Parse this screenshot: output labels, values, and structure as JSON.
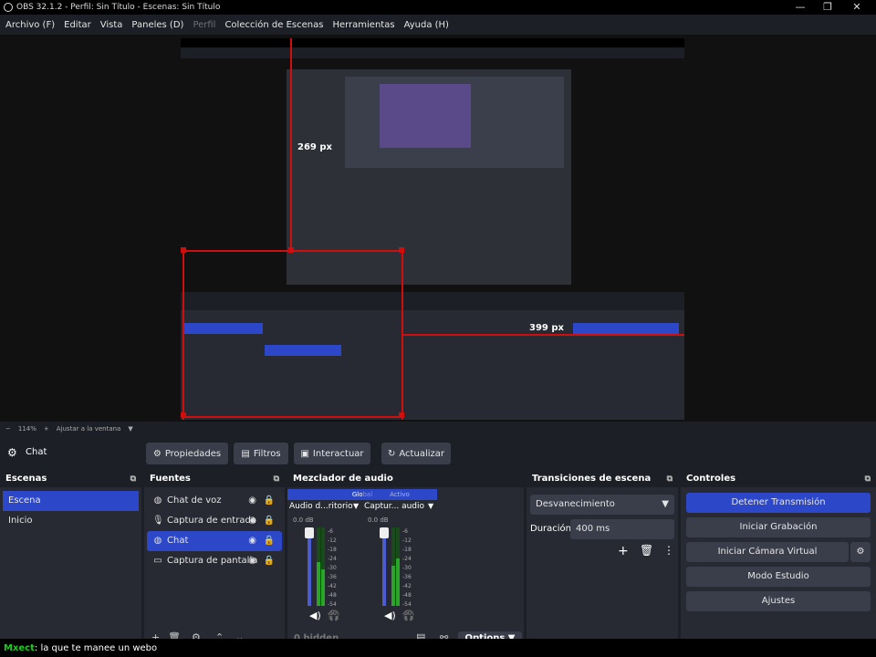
{
  "window": {
    "title": "OBS 32.1.2 - Perfil: Sin Título - Escenas: Sin Título",
    "min": "—",
    "max": "❐",
    "close": "✕"
  },
  "menu": [
    "Archivo (F)",
    "Editar",
    "Vista",
    "Paneles (D)",
    "Perfil",
    "Colección de Escenas",
    "Herramientas",
    "Ayuda (H)"
  ],
  "preview": {
    "label_top": "269 px",
    "label_right": "399 px"
  },
  "zoom": {
    "minus": "−",
    "value": "114%",
    "plus": "+",
    "fit": "Ajustar a la ventana"
  },
  "source_toolbar": {
    "name": "Chat",
    "properties": "Propiedades",
    "filters": "Filtros",
    "interact": "Interactuar",
    "refresh": "Actualizar"
  },
  "scenes": {
    "title": "Escenas",
    "items": [
      "Escena",
      "Inicio"
    ],
    "selected": 0
  },
  "sources": {
    "title": "Fuentes",
    "items": [
      {
        "icon": "chat-bubble-icon",
        "label": "Chat de voz"
      },
      {
        "icon": "microphone-icon",
        "label": "Captura de entrada"
      },
      {
        "icon": "chat-bubble-icon",
        "label": "Chat"
      },
      {
        "icon": "monitor-icon",
        "label": "Captura de pantalla"
      }
    ],
    "selected": 2
  },
  "mixer": {
    "title": "Mezclador de audio",
    "tab_global": "Global",
    "tab_active": "Activo",
    "channels": [
      {
        "name": "Audio d...ritorio",
        "db": "0.0 dB"
      },
      {
        "name": "Captur... audio",
        "db": "0.0 dB"
      }
    ],
    "scale": [
      "0",
      "-6",
      "-12",
      "-18",
      "-24",
      "-30",
      "-36",
      "-42",
      "-48",
      "-54",
      "-60"
    ],
    "hidden": "0 hidden",
    "options": "Options"
  },
  "transitions": {
    "title": "Transiciones de escena",
    "type": "Desvanecimiento",
    "duration_label": "Duración",
    "duration_value": "400 ms"
  },
  "controls": {
    "title": "Controles",
    "stop_stream": "Detener Transmisión",
    "start_record": "Iniciar Grabación",
    "virtual_cam": "Iniciar Cámara Virtual",
    "studio": "Modo Estudio",
    "settings": "Ajustes"
  },
  "chat": {
    "user": "Mxect",
    "message": ": la que te manee un webo"
  },
  "colors": {
    "accent": "#2c47c8",
    "red": "#d10e0e",
    "dock_bg": "#272a33",
    "bg": "#1d1f26"
  }
}
